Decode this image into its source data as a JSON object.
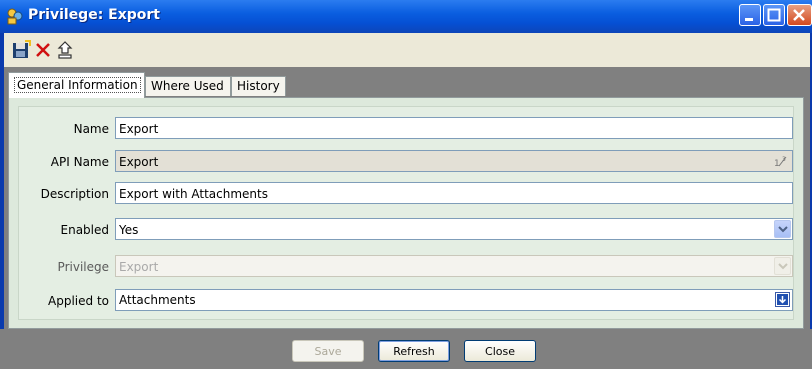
{
  "window": {
    "title": "Privilege: Export"
  },
  "toolbar": {
    "icons": [
      "save-icon",
      "delete-icon",
      "export-icon"
    ]
  },
  "tabs": [
    {
      "label": "General Information",
      "active": true
    },
    {
      "label": "Where Used",
      "active": false
    },
    {
      "label": "History",
      "active": false
    }
  ],
  "form": {
    "name": {
      "label": "Name",
      "value": "Export"
    },
    "api_name": {
      "label": "API Name",
      "value": "Export"
    },
    "description": {
      "label": "Description",
      "value": "Export with Attachments"
    },
    "enabled": {
      "label": "Enabled",
      "value": "Yes"
    },
    "privilege": {
      "label": "Privilege",
      "value": "Export"
    },
    "applied_to": {
      "label": "Applied to",
      "value": "Attachments"
    }
  },
  "footer": {
    "save_label": "Save",
    "refresh_label": "Refresh",
    "close_label": "Close"
  },
  "colors": {
    "titlebar": "#0a5ee0",
    "panel": "#dde9dc",
    "accent": "#003c74"
  }
}
